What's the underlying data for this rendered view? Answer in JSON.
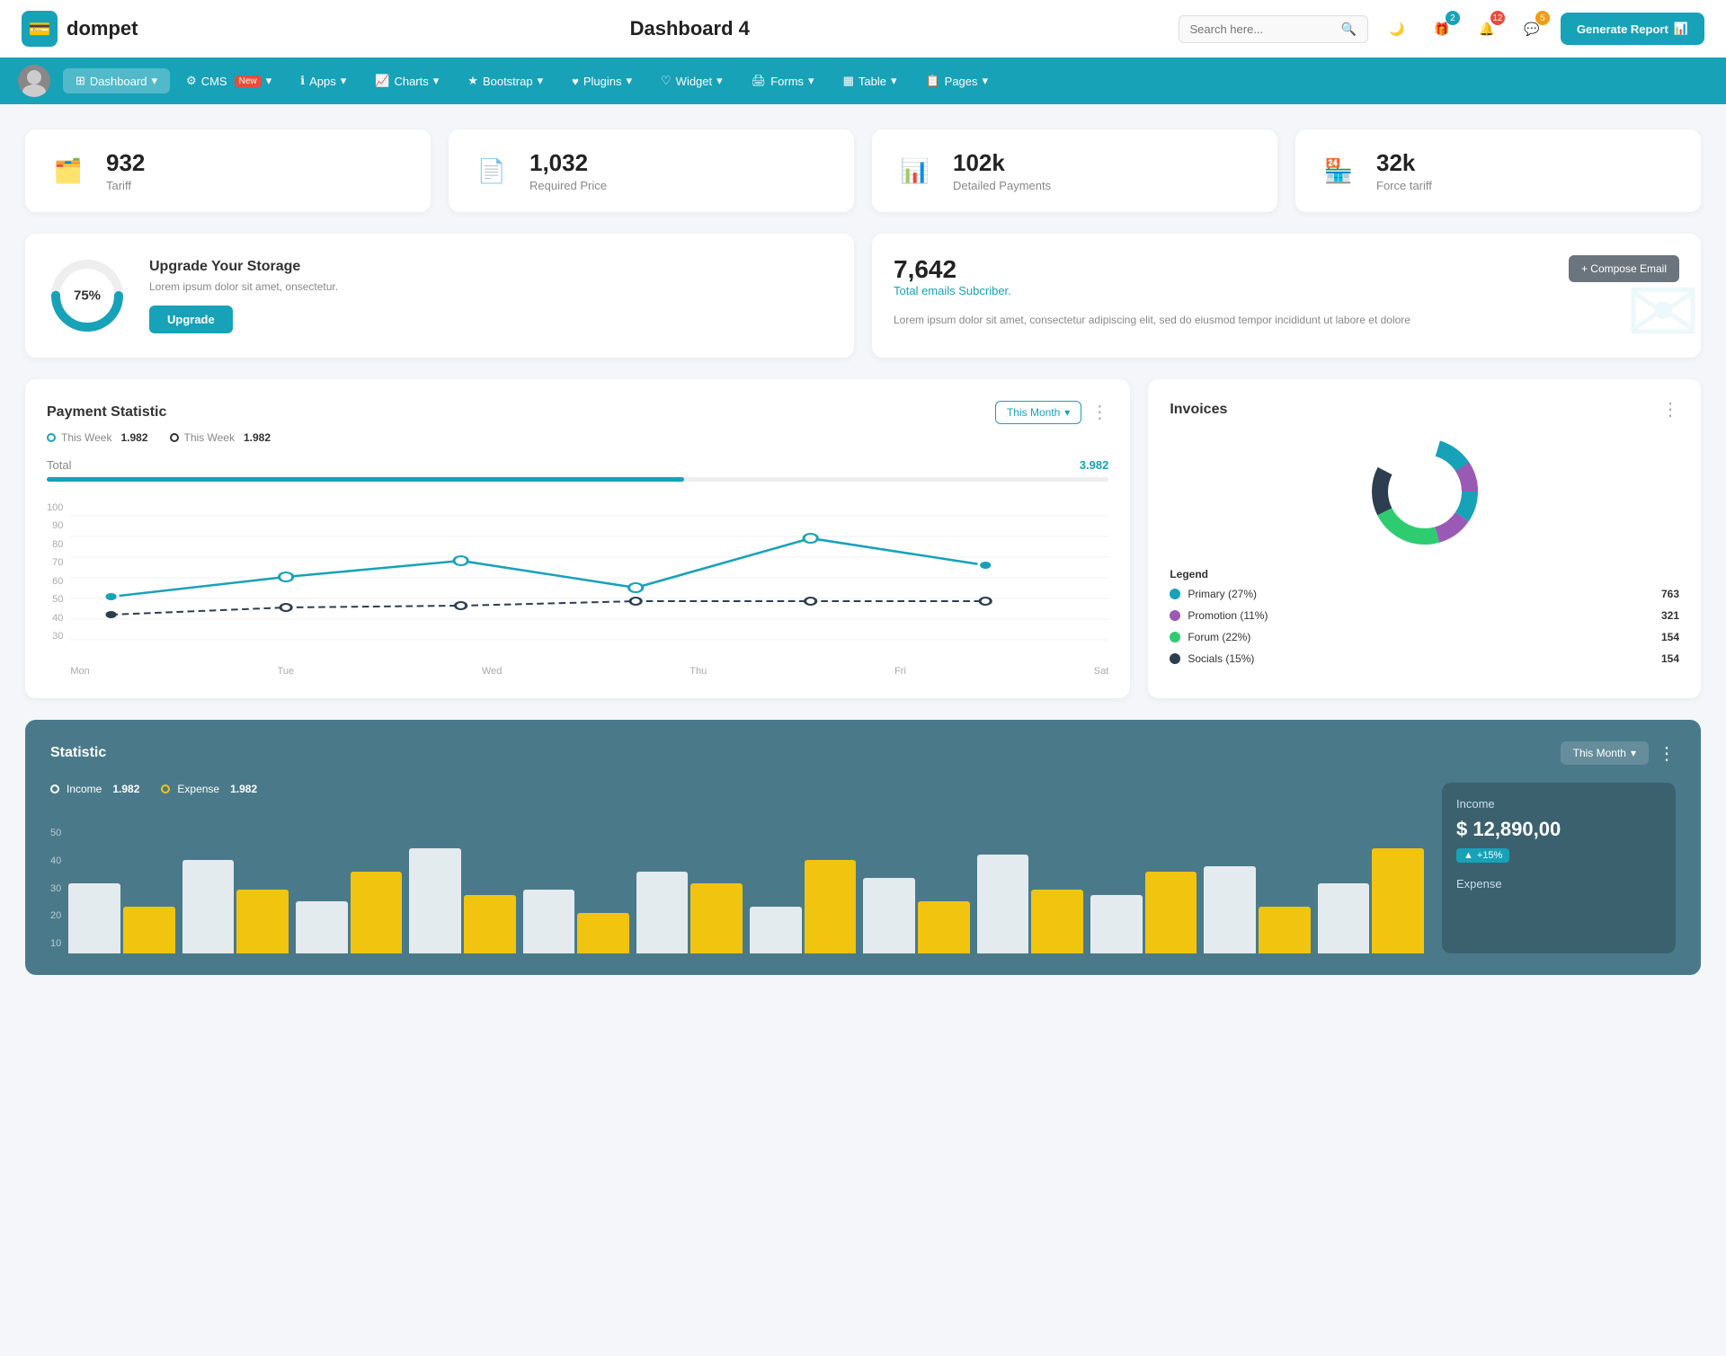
{
  "header": {
    "logo_icon": "💳",
    "logo_text": "dompet",
    "title": "Dashboard 4",
    "search_placeholder": "Search here...",
    "generate_report_label": "Generate Report"
  },
  "header_icons": {
    "moon_icon": "🌙",
    "gift_icon": "🎁",
    "gift_badge": "2",
    "bell_icon": "🔔",
    "bell_badge": "12",
    "chat_icon": "💬",
    "chat_badge": "5"
  },
  "navbar": {
    "items": [
      {
        "id": "dashboard",
        "label": "Dashboard",
        "active": true,
        "has_arrow": true
      },
      {
        "id": "cms",
        "label": "CMS",
        "active": false,
        "has_arrow": true,
        "badge": "New"
      },
      {
        "id": "apps",
        "label": "Apps",
        "active": false,
        "has_arrow": true
      },
      {
        "id": "charts",
        "label": "Charts",
        "active": false,
        "has_arrow": true
      },
      {
        "id": "bootstrap",
        "label": "Bootstrap",
        "active": false,
        "has_arrow": true
      },
      {
        "id": "plugins",
        "label": "Plugins",
        "active": false,
        "has_arrow": true
      },
      {
        "id": "widget",
        "label": "Widget",
        "active": false,
        "has_arrow": true
      },
      {
        "id": "forms",
        "label": "Forms",
        "active": false,
        "has_arrow": true
      },
      {
        "id": "table",
        "label": "Table",
        "active": false,
        "has_arrow": true
      },
      {
        "id": "pages",
        "label": "Pages",
        "active": false,
        "has_arrow": true
      }
    ]
  },
  "stat_cards": [
    {
      "id": "tariff",
      "value": "932",
      "label": "Tariff",
      "icon_type": "teal",
      "icon": "🗂️"
    },
    {
      "id": "required_price",
      "value": "1,032",
      "label": "Required Price",
      "icon_type": "red",
      "icon": "📄"
    },
    {
      "id": "detailed_payments",
      "value": "102k",
      "label": "Detailed Payments",
      "icon_type": "purple",
      "icon": "📊"
    },
    {
      "id": "force_tariff",
      "value": "32k",
      "label": "Force tariff",
      "icon_type": "pink",
      "icon": "🏪"
    }
  ],
  "storage": {
    "percent": 75,
    "percent_label": "75%",
    "title": "Upgrade Your Storage",
    "description": "Lorem ipsum dolor sit amet, onsectetur.",
    "button_label": "Upgrade"
  },
  "email": {
    "count": "7,642",
    "label": "Total emails Subcriber.",
    "description": "Lorem ipsum dolor sit amet, consectetur adipiscing elit, sed do eiusmod tempor incididunt ut labore et dolore",
    "compose_label": "+ Compose Email"
  },
  "payment_chart": {
    "title": "Payment Statistic",
    "filter_label": "This Month",
    "legend": [
      {
        "label": "This Week",
        "value": "1.982",
        "color": "teal"
      },
      {
        "label": "This Week",
        "value": "1.982",
        "color": "dark"
      }
    ],
    "total_label": "Total",
    "total_value": "3.982",
    "x_labels": [
      "Mon",
      "Tue",
      "Wed",
      "Thu",
      "Fri",
      "Sat"
    ],
    "y_labels": [
      "100",
      "90",
      "80",
      "70",
      "60",
      "50",
      "40",
      "30"
    ],
    "line1_points": "36,140 176,108 316,86 456,120 596,60 736,90",
    "line2_points": "36,160 176,152 316,152 456,143 596,143 736,143"
  },
  "invoices": {
    "title": "Invoices",
    "legend": [
      {
        "label": "Primary (27%)",
        "color": "#17a2b8",
        "count": "763"
      },
      {
        "label": "Promotion (11%)",
        "color": "#9b59b6",
        "count": "321"
      },
      {
        "label": "Forum (22%)",
        "color": "#2ecc71",
        "count": "154"
      },
      {
        "label": "Socials (15%)",
        "color": "#2c3e50",
        "count": "154"
      }
    ]
  },
  "statistic": {
    "title": "Statistic",
    "filter_label": "This Month",
    "legend": [
      {
        "label": "Income",
        "value": "1.982",
        "color": "white"
      },
      {
        "label": "Expense",
        "value": "1.982",
        "color": "yellow"
      }
    ],
    "y_labels": [
      "50",
      "40",
      "30",
      "20",
      "10"
    ],
    "income_panel": {
      "title": "Income",
      "amount": "$ 12,890,00",
      "badge": "+15%"
    },
    "bars": [
      {
        "white": 60,
        "yellow": 40
      },
      {
        "white": 80,
        "yellow": 55
      },
      {
        "white": 45,
        "yellow": 70
      },
      {
        "white": 90,
        "yellow": 50
      },
      {
        "white": 55,
        "yellow": 35
      },
      {
        "white": 70,
        "yellow": 60
      },
      {
        "white": 40,
        "yellow": 80
      },
      {
        "white": 65,
        "yellow": 45
      },
      {
        "white": 85,
        "yellow": 55
      },
      {
        "white": 50,
        "yellow": 70
      },
      {
        "white": 75,
        "yellow": 40
      },
      {
        "white": 60,
        "yellow": 90
      }
    ]
  }
}
